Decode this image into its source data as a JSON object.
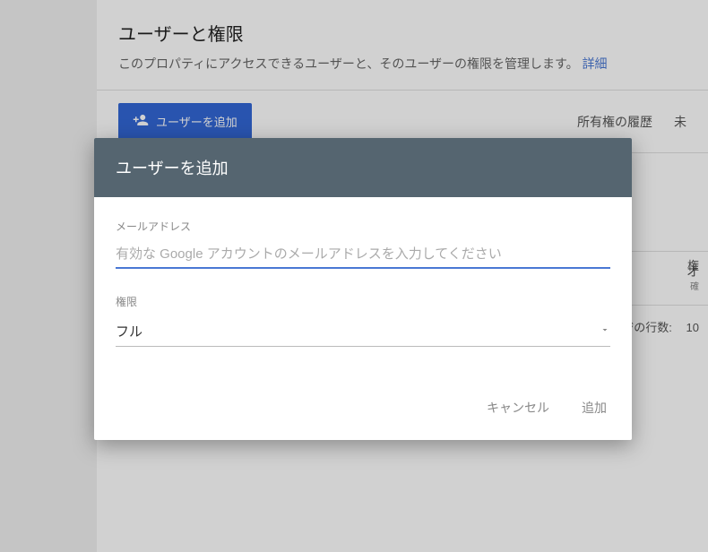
{
  "header": {
    "title": "ユーザーと権限",
    "subtitle": "このプロパティにアクセスできるユーザーと、そのユーザーの権限を管理します。",
    "details_link": "詳細"
  },
  "toolbar": {
    "add_user_label": "ユーザーを追加",
    "ownership_history": "所有権の履歴",
    "pending_prefix": "未"
  },
  "table": {
    "permission_header": "権",
    "row_main": "オ",
    "row_sub": "確",
    "pager_label": "ジの行数:",
    "pager_value": "10"
  },
  "dialog": {
    "title": "ユーザーを追加",
    "email_label": "メールアドレス",
    "email_placeholder": "有効な Google アカウントのメールアドレスを入力してください",
    "permission_label": "権限",
    "permission_value": "フル",
    "cancel_label": "キャンセル",
    "add_label": "追加"
  }
}
